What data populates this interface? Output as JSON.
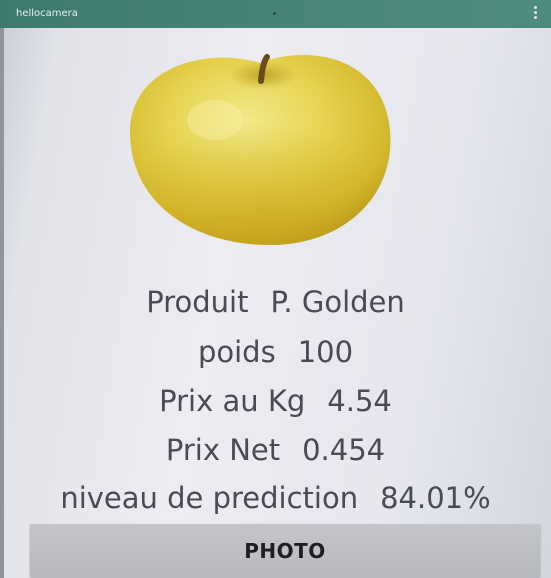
{
  "app": {
    "title": "hellocamera"
  },
  "photo": {
    "subject": "apple-image"
  },
  "info": {
    "produit": {
      "label": "Produit",
      "value": "P. Golden"
    },
    "poids": {
      "label": "poids",
      "value": "100"
    },
    "prix_kg": {
      "label": "Prix au Kg",
      "value": "4.54"
    },
    "prix_net": {
      "label": "Prix Net",
      "value": "0.454"
    },
    "prediction": {
      "label": "niveau de prediction",
      "value": "84.01%"
    }
  },
  "actions": {
    "photo_label": "PHOTO"
  },
  "colors": {
    "appbar": "#4a857b",
    "button": "#bdbfc4",
    "text": "#4a4b52"
  }
}
